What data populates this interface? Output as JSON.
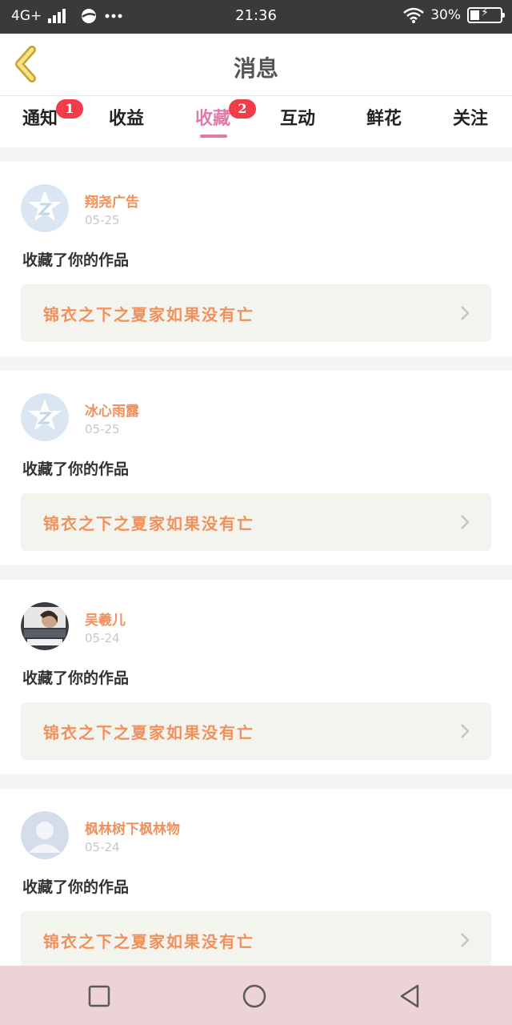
{
  "status_bar": {
    "network": "4G+",
    "time": "21:36",
    "battery": "30%",
    "battery_level": 0.3,
    "icons": [
      "signal-icon",
      "browser-icon",
      "more-dots-icon",
      "wifi-icon",
      "battery-icon"
    ]
  },
  "header": {
    "title": "消息",
    "back_icon": "chevron-left-icon"
  },
  "tabs": [
    {
      "label": "通知",
      "badge": "1"
    },
    {
      "label": "收益",
      "badge": ""
    },
    {
      "label": "收藏",
      "badge": "2",
      "active": true
    },
    {
      "label": "互动",
      "badge": ""
    },
    {
      "label": "鲜花",
      "badge": ""
    },
    {
      "label": "关注",
      "badge": ""
    }
  ],
  "items": [
    {
      "user": "翔尧广告",
      "date": "05-25",
      "action": "收藏了你的作品",
      "work": "锦衣之下之夏家如果没有亡",
      "avatar": "qq-default-avatar"
    },
    {
      "user": "冰心雨露",
      "date": "05-25",
      "action": "收藏了你的作品",
      "work": "锦衣之下之夏家如果没有亡",
      "avatar": "qq-default-avatar"
    },
    {
      "user": "吴羲儿",
      "date": "05-24",
      "action": "收藏了你的作品",
      "work": "锦衣之下之夏家如果没有亡",
      "avatar": "photo-avatar"
    },
    {
      "user": "枫林树下枫林物",
      "date": "05-24",
      "action": "收藏了你的作品",
      "work": "锦衣之下之夏家如果没有亡",
      "avatar": "person-silhouette-avatar"
    }
  ],
  "nav_bar": {
    "buttons": [
      "recent-apps-icon",
      "home-icon",
      "back-icon"
    ]
  },
  "colors": {
    "accent": "#e07aa8",
    "badge": "#f23c4a",
    "username": "#f0915c",
    "status_bar": "#3a3a3a",
    "nav_bar": "#ecd3d6"
  }
}
